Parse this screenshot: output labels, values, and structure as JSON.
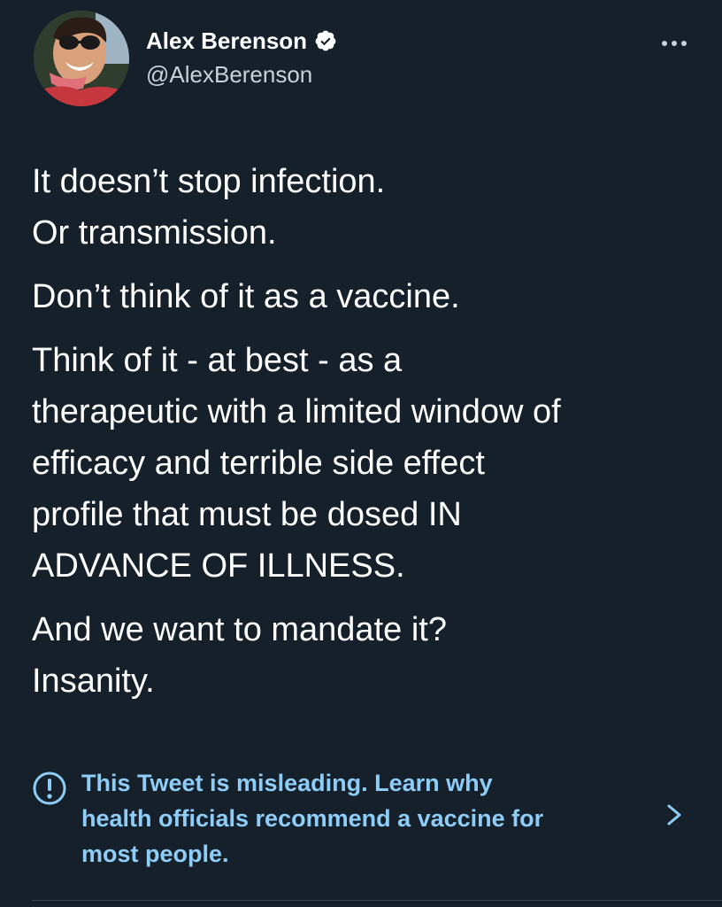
{
  "author": {
    "display_name": "Alex Berenson",
    "handle": "@AlexBerenson",
    "verified": true,
    "avatar_icon": "profile-photo"
  },
  "menu": {
    "icon": "more-options-icon"
  },
  "tweet": {
    "paragraphs": [
      [
        "It doesn’t stop infection.",
        "Or transmission."
      ],
      [
        "Don’t think of it as a vaccine."
      ],
      [
        "Think of it - at best - as a",
        "therapeutic with a limited window of",
        "efficacy and terrible side effect",
        "profile that must be dosed IN",
        "ADVANCE OF ILLNESS."
      ],
      [
        "And we want to mandate it?",
        "Insanity."
      ]
    ]
  },
  "notice": {
    "icon": "exclamation-circle-icon",
    "lines": [
      "This Tweet is misleading. Learn why",
      "health officials recommend a vaccine for",
      "most people."
    ],
    "chevron_icon": "chevron-right-icon"
  },
  "colors": {
    "background": "#15202b",
    "text": "#ffffff",
    "secondary_text": "#c9d1d9",
    "link": "#8ecdf8",
    "verified_badge": "#ffffff"
  }
}
